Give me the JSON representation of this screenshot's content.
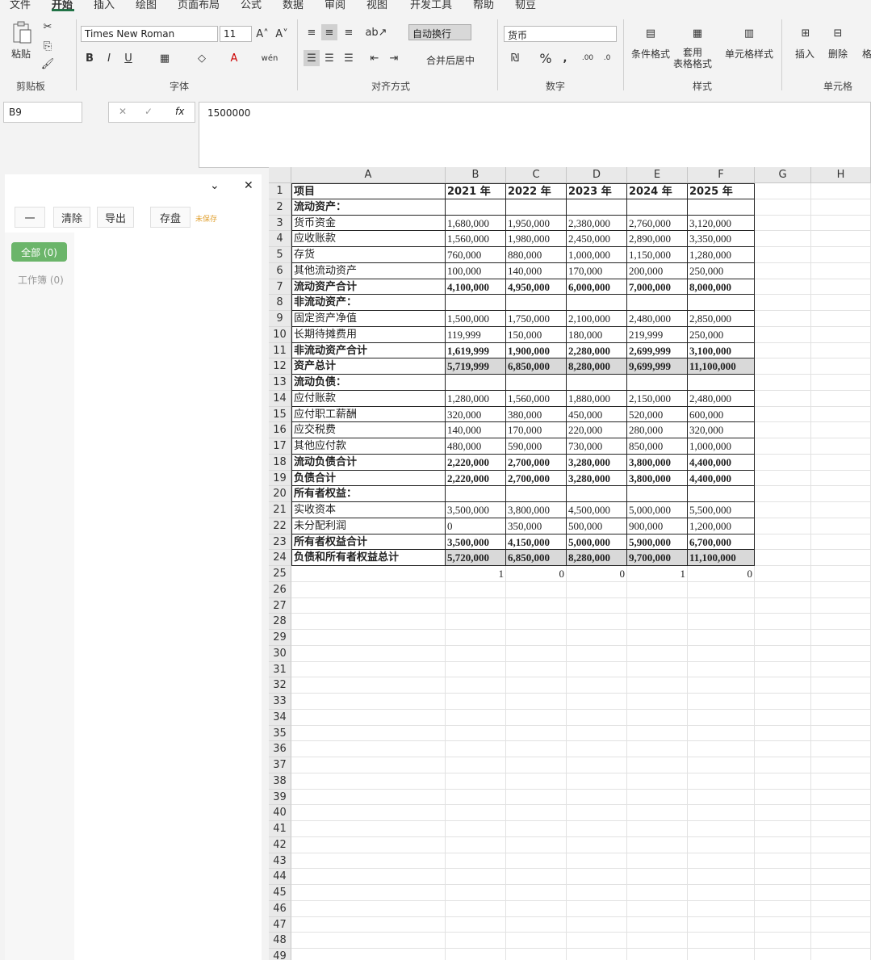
{
  "menu": [
    "文件",
    "开始",
    "插入",
    "绘图",
    "页面布局",
    "公式",
    "数据",
    "审阅",
    "视图",
    "开发工具",
    "帮助",
    "韧豆"
  ],
  "ribbon": {
    "paste_label": "粘贴",
    "clipboard_label": "剪贴板",
    "font_name": "Times New Roman",
    "font_size": "11",
    "font_group_label": "字体",
    "wrap_text_label": "自动换行",
    "merge_center_label": "合并后居中",
    "alignment_group_label": "对齐方式",
    "number_format": "货币",
    "number_group_label": "数字",
    "conditional_format_label": "条件格式",
    "table_format_label": "套用\n表格格式",
    "cell_style_label": "单元格样式",
    "styles_group_label": "样式",
    "insert_label": "插入",
    "delete_label": "删除",
    "format_label": "格",
    "cells_group_label": "单元格"
  },
  "formula_bar": {
    "name_box": "B9",
    "formula": "1500000"
  },
  "panel": {
    "buttons": [
      "一",
      "清除",
      "导出",
      "存盘"
    ],
    "unsaved": "未保存",
    "chip_all": "全部 (0)",
    "chip_workbook": "工作簿 (0)"
  },
  "columns": [
    "A",
    "B",
    "C",
    "D",
    "E",
    "F",
    "G",
    "H"
  ],
  "rows": [
    {
      "n": "1",
      "a": "项目",
      "v": [
        "2021 年",
        "2022 年",
        "2023 年",
        "2024 年",
        "2025 年"
      ],
      "bold": true
    },
    {
      "n": "2",
      "a": "流动资产：",
      "v": [
        "",
        "",
        "",
        "",
        ""
      ],
      "bold": true
    },
    {
      "n": "3",
      "a": "货币资金",
      "v": [
        "1,680,000",
        "1,950,000",
        "2,380,000",
        "2,760,000",
        "3,120,000"
      ]
    },
    {
      "n": "4",
      "a": "应收账款",
      "v": [
        "1,560,000",
        "1,980,000",
        "2,450,000",
        "2,890,000",
        "3,350,000"
      ]
    },
    {
      "n": "5",
      "a": "存货",
      "v": [
        "760,000",
        "880,000",
        "1,000,000",
        "1,150,000",
        "1,280,000"
      ]
    },
    {
      "n": "6",
      "a": "其他流动资产",
      "v": [
        "100,000",
        "140,000",
        "170,000",
        "200,000",
        "250,000"
      ]
    },
    {
      "n": "7",
      "a": "流动资产合计",
      "v": [
        "4,100,000",
        "4,950,000",
        "6,000,000",
        "7,000,000",
        "8,000,000"
      ],
      "bold": true
    },
    {
      "n": "8",
      "a": "非流动资产：",
      "v": [
        "",
        "",
        "",
        "",
        ""
      ],
      "bold": true
    },
    {
      "n": "9",
      "a": "固定资产净值",
      "v": [
        "1,500,000",
        "1,750,000",
        "2,100,000",
        "2,480,000",
        "2,850,000"
      ]
    },
    {
      "n": "10",
      "a": "长期待摊费用",
      "v": [
        "119,999",
        "150,000",
        "180,000",
        "219,999",
        "250,000"
      ]
    },
    {
      "n": "11",
      "a": "非流动资产合计",
      "v": [
        "1,619,999",
        "1,900,000",
        "2,280,000",
        "2,699,999",
        "3,100,000"
      ],
      "bold": true
    },
    {
      "n": "12",
      "a": "资产总计",
      "v": [
        "5,719,999",
        "6,850,000",
        "8,280,000",
        "9,699,999",
        "11,100,000"
      ],
      "bold": true,
      "gray": true
    },
    {
      "n": "13",
      "a": "流动负债：",
      "v": [
        "",
        "",
        "",
        "",
        ""
      ],
      "bold": true
    },
    {
      "n": "14",
      "a": "应付账款",
      "v": [
        "1,280,000",
        "1,560,000",
        "1,880,000",
        "2,150,000",
        "2,480,000"
      ]
    },
    {
      "n": "15",
      "a": "应付职工薪酬",
      "v": [
        "320,000",
        "380,000",
        "450,000",
        "520,000",
        "600,000"
      ]
    },
    {
      "n": "16",
      "a": "应交税费",
      "v": [
        "140,000",
        "170,000",
        "220,000",
        "280,000",
        "320,000"
      ]
    },
    {
      "n": "17",
      "a": "其他应付款",
      "v": [
        "480,000",
        "590,000",
        "730,000",
        "850,000",
        "1,000,000"
      ]
    },
    {
      "n": "18",
      "a": "流动负债合计",
      "v": [
        "2,220,000",
        "2,700,000",
        "3,280,000",
        "3,800,000",
        "4,400,000"
      ],
      "bold": true
    },
    {
      "n": "19",
      "a": "负债合计",
      "v": [
        "2,220,000",
        "2,700,000",
        "3,280,000",
        "3,800,000",
        "4,400,000"
      ],
      "bold": true
    },
    {
      "n": "20",
      "a": "所有者权益：",
      "v": [
        "",
        "",
        "",
        "",
        ""
      ],
      "bold": true
    },
    {
      "n": "21",
      "a": "实收资本",
      "v": [
        "3,500,000",
        "3,800,000",
        "4,500,000",
        "5,000,000",
        "5,500,000"
      ]
    },
    {
      "n": "22",
      "a": "未分配利润",
      "v": [
        "0",
        "350,000",
        "500,000",
        "900,000",
        "1,200,000"
      ]
    },
    {
      "n": "23",
      "a": "所有者权益合计",
      "v": [
        "3,500,000",
        "4,150,000",
        "5,000,000",
        "5,900,000",
        "6,700,000"
      ],
      "bold": true
    },
    {
      "n": "24",
      "a": "负债和所有者权益总计",
      "v": [
        "5,720,000",
        "6,850,000",
        "8,280,000",
        "9,700,000",
        "11,100,000"
      ],
      "bold": true,
      "gray": true
    }
  ],
  "row25": [
    "1",
    "0",
    "0",
    "1",
    "0"
  ],
  "empty_rows": [
    "25",
    "26",
    "27",
    "28",
    "29",
    "30",
    "31",
    "32",
    "33",
    "34",
    "35",
    "36",
    "37",
    "38",
    "39",
    "40",
    "41",
    "42",
    "43",
    "44",
    "45",
    "46",
    "47",
    "48",
    "49"
  ]
}
